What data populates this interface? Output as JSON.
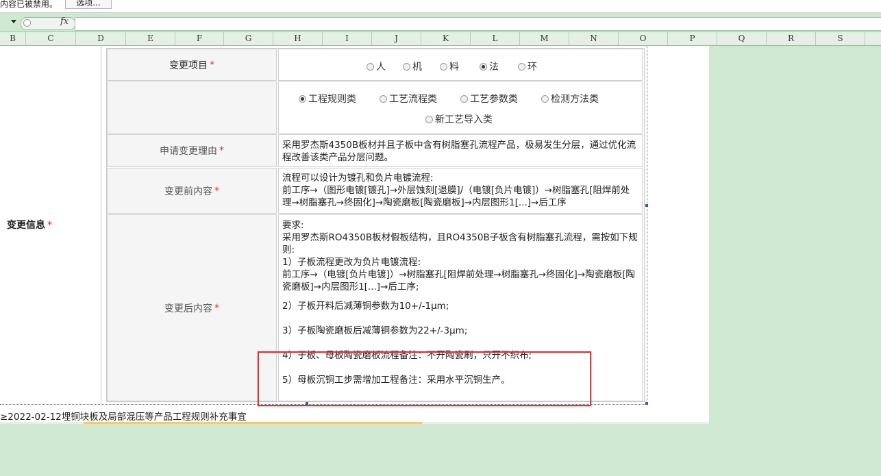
{
  "notice": {
    "text": "内容已被禁用。",
    "options_button": "选项..."
  },
  "formula_bar": {
    "fx_label": "fx",
    "value": ""
  },
  "columns": [
    "B",
    "C",
    "D",
    "E",
    "F",
    "G",
    "H",
    "I",
    "J",
    "K",
    "L",
    "M",
    "N",
    "O",
    "P",
    "Q",
    "R",
    "S"
  ],
  "row_label": {
    "text": "变更信息",
    "star": "*"
  },
  "form": {
    "required_star": "*",
    "change_item": {
      "label": "变更项目",
      "options": [
        {
          "label": "人",
          "checked": false
        },
        {
          "label": "机",
          "checked": false
        },
        {
          "label": "料",
          "checked": false
        },
        {
          "label": "法",
          "checked": true
        },
        {
          "label": "环",
          "checked": false
        }
      ]
    },
    "change_category": {
      "options_row1": [
        {
          "label": "工程规则类",
          "checked": true
        },
        {
          "label": "工艺流程类",
          "checked": false
        },
        {
          "label": "工艺参数类",
          "checked": false
        },
        {
          "label": "检测方法类",
          "checked": false
        }
      ],
      "options_row2": [
        {
          "label": "新工艺导入类",
          "checked": false
        }
      ]
    },
    "reason": {
      "label": "申请变更理由",
      "value": "采用罗杰斯4350B板材并且子板中含有树脂塞孔流程产品，极易发生分层，通过优化流程改善该类产品分层问题。"
    },
    "before": {
      "label": "变更前内容",
      "lines": [
        "流程可以设计为镀孔和负片电镀流程:",
        "前工序→（图形电镀[镀孔]→外层蚀刻[退膜]/（电镀[负片电镀]）→树脂塞孔[阻焊前处理→树脂塞孔→终固化]→陶瓷磨板[陶瓷磨板]→内层图形1[...]→后工序"
      ]
    },
    "after": {
      "label": "变更后内容",
      "intro": [
        "要求:",
        "采用罗杰斯RO4350B板材假板结构，且RO4350B子板含有树脂塞孔流程，需按如下规则:",
        "1）子板流程更改为负片电镀流程:",
        "前工序→（电镀[负片电镀]）→树脂塞孔[阻焊前处理→树脂塞孔→终固化]→陶瓷磨板[陶瓷磨板]→内层图形1[...]→后工序;"
      ],
      "item2": "2）子板开料后减薄铜参数为10+/-1μm;",
      "item3": "3）子板陶瓷磨板后减薄铜参数为22+/-3μm;",
      "item4": "4）子板、母板陶瓷磨板流程备注：不开陶瓷刷，只开不织布;",
      "item5": "5）母板沉铜工步需增加工程备注：采用水平沉铜生产。"
    }
  },
  "bottom_row_text": "≥2022-02-12埋铜块板及局部混压等产品工程规则补充事宜"
}
